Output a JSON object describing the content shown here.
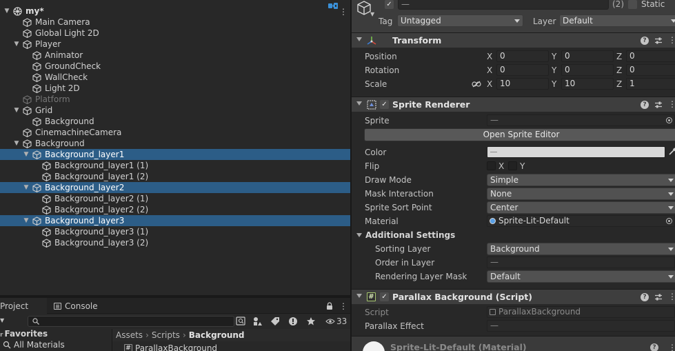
{
  "hierarchy": {
    "scene_name": "my*",
    "search_placeholder": "All",
    "rows": [
      {
        "label": "my*",
        "depth": 0,
        "arrow": "down",
        "type": "scene",
        "selected": false,
        "disabled": false
      },
      {
        "label": "Main Camera",
        "depth": 1,
        "arrow": "",
        "type": "object",
        "selected": false,
        "disabled": false
      },
      {
        "label": "Global Light 2D",
        "depth": 1,
        "arrow": "",
        "type": "object",
        "selected": false,
        "disabled": false
      },
      {
        "label": "Player",
        "depth": 1,
        "arrow": "down",
        "type": "object",
        "selected": false,
        "disabled": false
      },
      {
        "label": "Animator",
        "depth": 2,
        "arrow": "",
        "type": "object",
        "selected": false,
        "disabled": false
      },
      {
        "label": "GroundCheck",
        "depth": 2,
        "arrow": "",
        "type": "object",
        "selected": false,
        "disabled": false
      },
      {
        "label": "WallCheck",
        "depth": 2,
        "arrow": "",
        "type": "object",
        "selected": false,
        "disabled": false
      },
      {
        "label": "Light 2D",
        "depth": 2,
        "arrow": "",
        "type": "object",
        "selected": false,
        "disabled": false
      },
      {
        "label": "Platform",
        "depth": 1,
        "arrow": "",
        "type": "object",
        "selected": false,
        "disabled": true
      },
      {
        "label": "Grid",
        "depth": 1,
        "arrow": "down",
        "type": "object",
        "selected": false,
        "disabled": false
      },
      {
        "label": "Background",
        "depth": 2,
        "arrow": "",
        "type": "object",
        "selected": false,
        "disabled": false
      },
      {
        "label": "CinemachineCamera",
        "depth": 1,
        "arrow": "",
        "type": "object",
        "selected": false,
        "disabled": false
      },
      {
        "label": "Background",
        "depth": 1,
        "arrow": "down",
        "type": "object",
        "selected": false,
        "disabled": false
      },
      {
        "label": "Background_layer1",
        "depth": 2,
        "arrow": "down",
        "type": "object",
        "selected": true,
        "disabled": false
      },
      {
        "label": "Background_layer1 (1)",
        "depth": 3,
        "arrow": "",
        "type": "object",
        "selected": false,
        "disabled": false
      },
      {
        "label": "Background_layer1 (2)",
        "depth": 3,
        "arrow": "",
        "type": "object",
        "selected": false,
        "disabled": false
      },
      {
        "label": "Background_layer2",
        "depth": 2,
        "arrow": "down",
        "type": "object",
        "selected": true,
        "disabled": false
      },
      {
        "label": "Background_layer2 (1)",
        "depth": 3,
        "arrow": "",
        "type": "object",
        "selected": false,
        "disabled": false
      },
      {
        "label": "Background_layer2 (2)",
        "depth": 3,
        "arrow": "",
        "type": "object",
        "selected": false,
        "disabled": false
      },
      {
        "label": "Background_layer3",
        "depth": 2,
        "arrow": "down",
        "type": "object",
        "selected": true,
        "disabled": false
      },
      {
        "label": "Background_layer3 (1)",
        "depth": 3,
        "arrow": "",
        "type": "object",
        "selected": false,
        "disabled": false
      },
      {
        "label": "Background_layer3 (2)",
        "depth": 3,
        "arrow": "",
        "type": "object",
        "selected": false,
        "disabled": false
      }
    ],
    "cinemachine_icon_row": "Main Camera"
  },
  "project": {
    "tabs": {
      "project": "Project",
      "console": "Console"
    },
    "hidden_count": "33",
    "favorites_heading": "Favorites",
    "favorites_item": "All Materials",
    "breadcrumb": [
      "Assets",
      "Scripts",
      "Background"
    ],
    "asset_item": "ParallaxBackground"
  },
  "inspector": {
    "header": {
      "name_value": "—",
      "count": "(2)",
      "static_label": "Static",
      "tag_label": "Tag",
      "tag_value": "Untagged",
      "layer_label": "Layer",
      "layer_value": "Default"
    },
    "transform": {
      "title": "Transform",
      "position_label": "Position",
      "rotation_label": "Rotation",
      "scale_label": "Scale",
      "position": {
        "x": "0",
        "y": "0",
        "z": "0"
      },
      "rotation": {
        "x": "0",
        "y": "0",
        "z": "0"
      },
      "scale": {
        "x": "10",
        "y": "10",
        "z": "1"
      },
      "axis_x": "X",
      "axis_y": "Y",
      "axis_z": "Z"
    },
    "sprite_renderer": {
      "title": "Sprite Renderer",
      "sprite_label": "Sprite",
      "sprite_value": "—",
      "open_editor_button": "Open Sprite Editor",
      "color_label": "Color",
      "flip_label": "Flip",
      "flip_x": "X",
      "flip_y": "Y",
      "draw_mode_label": "Draw Mode",
      "draw_mode_value": "Simple",
      "mask_interaction_label": "Mask Interaction",
      "mask_interaction_value": "None",
      "sort_point_label": "Sprite Sort Point",
      "sort_point_value": "Center",
      "material_label": "Material",
      "material_value": "Sprite-Lit-Default",
      "additional_settings_label": "Additional Settings",
      "sorting_layer_label": "Sorting Layer",
      "sorting_layer_value": "Background",
      "order_in_layer_label": "Order in Layer",
      "order_in_layer_value": "—",
      "rendering_layer_mask_label": "Rendering Layer Mask",
      "rendering_layer_mask_value": "Default"
    },
    "parallax": {
      "title": "Parallax Background (Script)",
      "script_label": "Script",
      "script_value": "ParallaxBackground",
      "effect_label": "Parallax Effect",
      "effect_value": "—"
    },
    "material_preview": {
      "title": "Sprite-Lit-Default (Material)"
    }
  },
  "colors": {
    "selection": "#2c5d87",
    "panel": "#282828",
    "header": "#3e3e3e",
    "field": "#2a2a2a",
    "dropdown": "#515151"
  }
}
